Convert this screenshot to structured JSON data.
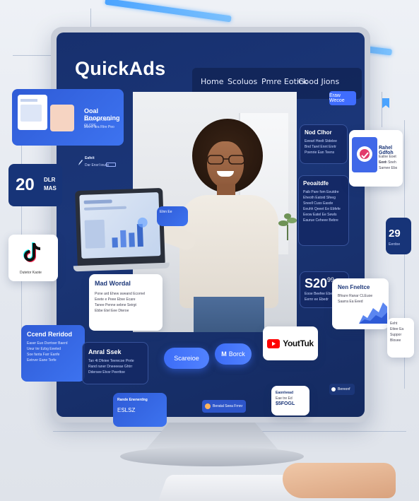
{
  "brand": {
    "name": "QuickAds"
  },
  "nav": {
    "items": [
      "Home",
      "Scoluos",
      "Pmre Eotick",
      "Good Jions"
    ],
    "cta": "Eraw Wecoe"
  },
  "left_cards": {
    "top": {
      "title": "Ooal Bnoprening",
      "lines": [
        "Boree! Tarl Zuvw QLCRE",
        "Buvre ara Rtre Peo"
      ]
    },
    "stat": {
      "number": "20",
      "label_top": "DLR",
      "label_bottom": "MAS"
    },
    "tiktok": {
      "label": "Dutetor Kaote"
    },
    "bottom": {
      "title": "Ccend Reridod",
      "lines": [
        "Easer Euo Dsrrtoer Baerd",
        "Ueur tnr Ezbg Eeeted",
        "Soe fanta Farr Eanfe",
        "Eetrver Eane Terfe"
      ]
    }
  },
  "screen_left": {
    "small": {
      "title": "Eafeit",
      "lines": [
        "Dar Ensrl ieuse"
      ]
    },
    "white_card": {
      "title": "Mad Wordal",
      "lines": [
        "Pone ard Ehew sweand Ecornel",
        "Eeete e Peee Ebve Ecare",
        "Tanee Penne sebne Seirgt",
        "Ebbe Etel Eee Dteroe"
      ]
    },
    "anal": {
      "title": "Anral Ssek",
      "lines": [
        "Tan 4t Dfeiee Teerecoe Pnrte",
        "Rand raner Dneeeeae Ghtrr",
        "Ddersee Etvsr Peerttoe"
      ]
    }
  },
  "screen_right": {
    "top": {
      "title": "Nod Clhor",
      "lines": [
        "Eeearl Heelt Stdelee",
        "Bnd Tarel Ennt Enrtr",
        "Poenrie Ean Teens"
      ]
    },
    "mid": {
      "title": "Peoaitdfe",
      "lines": [
        "Paib Pare fom Eeutdre",
        "Eheoth Eatoid Sfeeg",
        "Sneell Cuss Easde",
        "Eeuhh Qeeet Ee Ebfefe",
        "Eeow Eatel Ee Sewls",
        "Eaurue Ceheee Bebre"
      ]
    },
    "price": {
      "value": "S20",
      "sup": "99",
      "lines": [
        "Eooe Beefee Ebeet",
        "Eernr ee Ebedr"
      ]
    }
  },
  "right_cards": {
    "top": {
      "title": "Rahel Gdfoh",
      "lines": [
        "Eatne Eoet Sem",
        "Eeeh Sneh",
        "Sarnee Ebs"
      ]
    },
    "stat": {
      "number": "29",
      "label": "Eerdoe"
    },
    "campaign": {
      "title": "Nen Fneltce",
      "lines": [
        "Bfoure Ranar CLEuoe",
        "Saarra Ea Eeed"
      ]
    },
    "small_edge": {
      "lines": [
        "Eeht",
        "Ettee Ea",
        "Suppor",
        "Blovee"
      ]
    }
  },
  "buttons": {
    "primary": "Scareioe",
    "secondary": "Borck",
    "youtube": "YoutTuk",
    "laptop_badge": "Elnn Ee"
  },
  "bottom_row": {
    "blue_card": {
      "title": "Rande Enenerdng",
      "value": "ESLSZ"
    },
    "pill": "Beratal Seea Frnnr",
    "white_card": {
      "title": "Eaonlvead",
      "lines": [
        "Eae tre Ed",
        "$5FOGL"
      ]
    },
    "small_pill": "Bereonf"
  },
  "colors": {
    "screen_bg": "#17306e",
    "accent_blue": "#3f6dff",
    "youtube_red": "#ff0000",
    "tiktok_pink": "#ff2d55",
    "tiktok_cyan": "#25f4ee"
  }
}
